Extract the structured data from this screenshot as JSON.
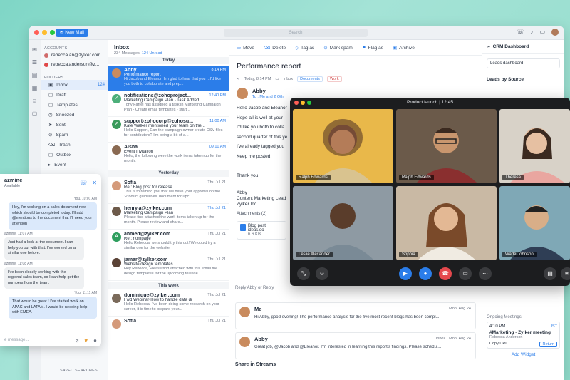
{
  "toolbar": {
    "new_mail": "New Mail",
    "search_placeholder": "Search"
  },
  "accounts": {
    "heading": "ACCOUNTS",
    "items": [
      {
        "email": "rebecca.an@zylker.com"
      },
      {
        "email": "rebecca.anderson@z..."
      }
    ]
  },
  "folders": {
    "heading": "FOLDERS",
    "items": [
      {
        "label": "Inbox",
        "count": "124"
      },
      {
        "label": "Draft"
      },
      {
        "label": "Templates"
      },
      {
        "label": "Snoozed"
      },
      {
        "label": "Sent"
      },
      {
        "label": "Spam"
      },
      {
        "label": "Trash"
      },
      {
        "label": "Outbox"
      },
      {
        "label": "Event"
      }
    ],
    "saved": "SAVED SEARCHES"
  },
  "inbox": {
    "title": "Inbox",
    "count_text": "234 Messages,",
    "unread": "124 Unread",
    "groups": {
      "today": "Today",
      "yesterday": "Yesterday",
      "week": "This week"
    },
    "mails": [
      {
        "from": "Abby",
        "time": "8:14 PM",
        "subject": "Performance report",
        "preview": "Hi Jacob and Eleanor! I'm glad to hear that you ...I'd like you both to collaborate and prep..."
      },
      {
        "from": "notifications@zohoproject...",
        "time": "12:40 PM",
        "subject": "Marketing Campaign Plan - Task Added",
        "preview": "Tony Farrel has assigned a task in Marketing Campaign Plan - Create email templates - start..."
      },
      {
        "from": "support-zohocorp@zohosu...",
        "time": "11:00 AM",
        "subject": "Kate Walker mentioned your team on the...",
        "preview": "Hello Support, Can the campaign owner create CSV files for contributors? I'm being a bit of a..."
      },
      {
        "from": "Aisha",
        "time": "09.10 AM",
        "subject": "Event Invitation",
        "preview": "Hello, the following were the work items taken up for the month."
      },
      {
        "from": "Sofia",
        "time": "Thu Jul 21",
        "subject": "Re : Blog post for release",
        "preview": "This is to remind you that we have your approval on the 'Product guidelines' document for upc..."
      },
      {
        "from": "henry.a@zylker.com",
        "time": "Thu Jul 21",
        "subject": "Marketing Campaign Plan",
        "preview": "Please find attached the work items taken up for the month. Please review and share..."
      },
      {
        "from": "ahmed@zylker.com",
        "time": "Thu Jul 21",
        "subject": "Re : hompage",
        "preview": "Hello Rebecca, we should try this out! We could try a similar one for the website."
      },
      {
        "from": "jamar@zylker.com",
        "time": "Thu Jul 21",
        "subject": "Website design templates",
        "preview": "Hey Rebecca, Please find attached with this email the design templates for the upcoming release..."
      },
      {
        "from": "dominique@zylker.com",
        "time": "Thu Jul 21",
        "subject": "Fwd  Webinar-How to handle data di",
        "preview": "Hello Rebecca, I've been doing some research on your career, it is time to prepare your..."
      },
      {
        "from": "Sofia",
        "time": "Thu Jul 21",
        "subject": "",
        "preview": ""
      }
    ]
  },
  "reader": {
    "actions": [
      "Move",
      "Delete",
      "Tag as",
      "Mark spam",
      "Flag as",
      "Archive"
    ],
    "title": "Performance report",
    "date": "Today, 8:14 PM",
    "folder": "Inbox",
    "tags": [
      "Documents",
      "Work"
    ],
    "sender": "Abby",
    "to": "To : Me and 2 Oth",
    "body": [
      "Hello Jacob and Eleanor",
      "Hope all is well at your",
      "I'd like you both to colla",
      "second quarter of this ye",
      "I've already tagged you",
      "Keep me posted.",
      "",
      "Thank you,",
      "",
      "Abby",
      "Content Marketing Lead",
      "Zylker Inc."
    ],
    "attachments": "Attachments (2)",
    "file": {
      "name": "Blog post ideas.do",
      "size": "6.6 KB"
    },
    "reply": "Reply Abby or Reply",
    "threads": [
      {
        "from": "Me",
        "date": "Mon, Aug 24",
        "text": "Hi Abby, good evening! The performance analysis for the five most recent blogs has been compl..."
      },
      {
        "from": "Abby",
        "date": "Mon, Aug 24",
        "tag": "Inbox",
        "text": "Great job, @Jacob and @Eleanor. I'm interested in learning this report's findings. Please schedul..."
      }
    ],
    "streams": "Share in Streams"
  },
  "crm": {
    "title": "CRM Dashboard",
    "select": "Leads dashboard",
    "section": "Leads by Source",
    "meetings_title": "Ongoing Meetings",
    "meeting_time": "4:10 PM",
    "live": "IST",
    "meeting_name": "#Marketing - Zylker meeting",
    "meeting_host": "Rebecca Anderson",
    "copy": "Copy URL",
    "return": "Return",
    "add_widget": "Add Widget"
  },
  "video": {
    "title": "Product launch | 12:45",
    "participants": [
      {
        "name": "Ralph Edwards"
      },
      {
        "name": "Ralph Edwards"
      },
      {
        "name": "Theresa"
      },
      {
        "name": "Leslie Alexander"
      },
      {
        "name": "Sophia"
      },
      {
        "name": "Wade Johnson"
      }
    ]
  },
  "chat": {
    "name": "azmine",
    "status": "Available",
    "placeholder": "e message...",
    "messages": [
      {
        "time": "You, 10:01 AM",
        "text": "Hey, I'm working on a sales document now which should be completed today. I'll add @mentions to the document that I'll need your attention"
      },
      {
        "name": "azmine, 11:07 AM",
        "text": "Just had a look at the document.I can help you out with that. I've worked on a similar one before."
      },
      {
        "name": "azmine, 11:08 AM",
        "text": "I've been closely working with the regional sales team, so I can help get the numbers from the team."
      },
      {
        "time": "You, 11:11 AM",
        "text": "That would be great ! I've started work on APAC and LATAM. I would be needing help with EMEA."
      }
    ]
  }
}
